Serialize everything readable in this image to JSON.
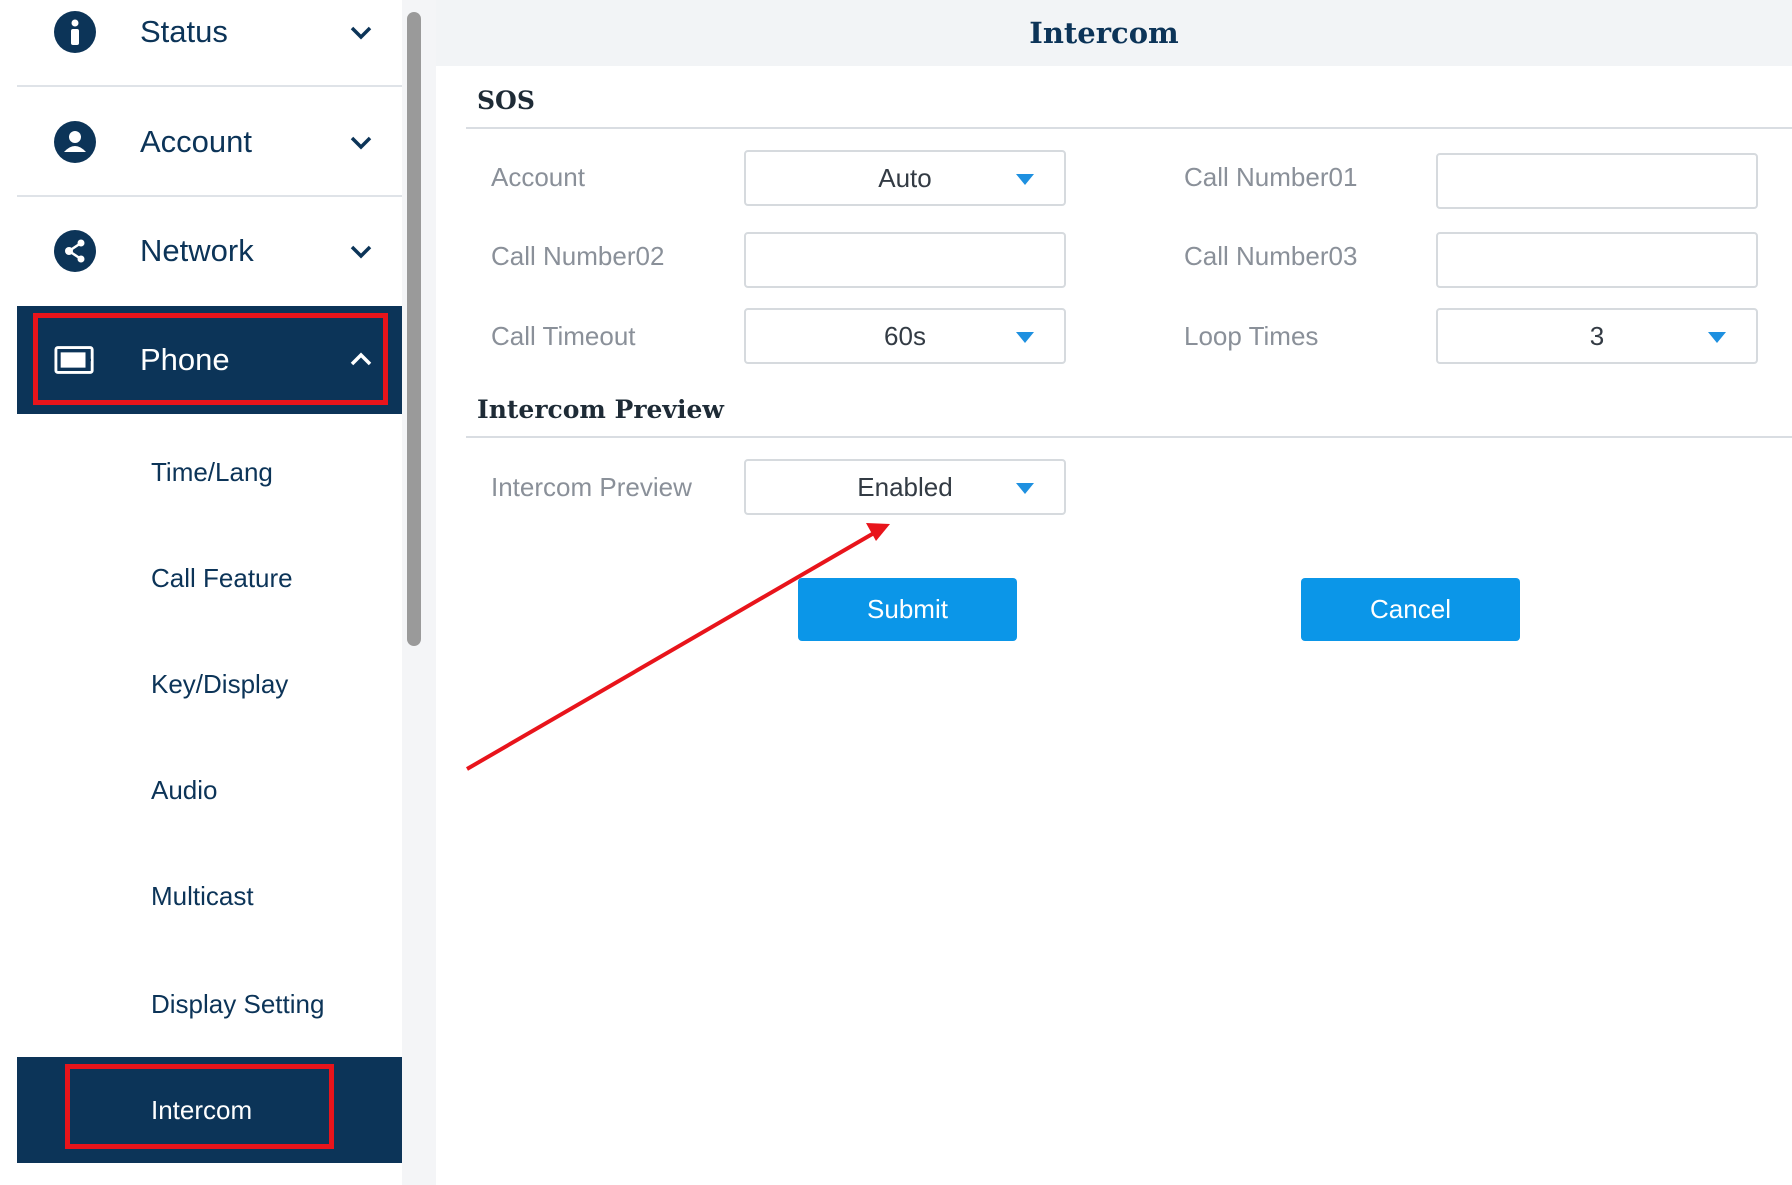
{
  "sidebar": {
    "items": [
      {
        "label": "Status",
        "icon": "info-icon"
      },
      {
        "label": "Account",
        "icon": "user-icon"
      },
      {
        "label": "Network",
        "icon": "network-icon"
      },
      {
        "label": "Phone",
        "icon": "phone-device-icon"
      }
    ],
    "sub_items": [
      {
        "label": "Time/Lang"
      },
      {
        "label": "Call Feature"
      },
      {
        "label": "Key/Display"
      },
      {
        "label": "Audio"
      },
      {
        "label": "Multicast"
      },
      {
        "label": "Display Setting"
      },
      {
        "label": "Intercom"
      }
    ],
    "active_item": "Phone",
    "active_sub_item": "Intercom"
  },
  "header": {
    "title": "Intercom"
  },
  "sos": {
    "title": "SOS",
    "account_label": "Account",
    "account_value": "Auto",
    "call_number01_label": "Call Number01",
    "call_number01_value": "",
    "call_number02_label": "Call Number02",
    "call_number02_value": "",
    "call_number03_label": "Call Number03",
    "call_number03_value": "",
    "call_timeout_label": "Call Timeout",
    "call_timeout_value": "60s",
    "loop_times_label": "Loop Times",
    "loop_times_value": "3"
  },
  "intercom_preview": {
    "title": "Intercom Preview",
    "label": "Intercom Preview",
    "value": "Enabled"
  },
  "buttons": {
    "submit": "Submit",
    "cancel": "Cancel"
  },
  "colors": {
    "nav_dark": "#0c3458",
    "accent": "#0b96e8",
    "highlight": "#e8141b"
  }
}
